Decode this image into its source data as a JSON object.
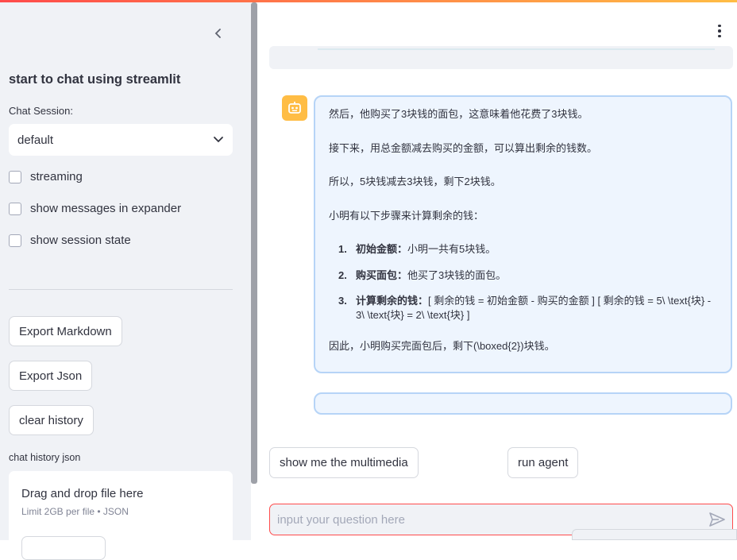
{
  "sidebar": {
    "title": "start to chat using streamlit",
    "session_label": "Chat Session:",
    "session_value": "default",
    "checkboxes": [
      {
        "label": "streaming",
        "checked": false
      },
      {
        "label": "show messages in expander",
        "checked": false
      },
      {
        "label": "show session state",
        "checked": false
      }
    ],
    "buttons": {
      "export_markdown": "Export Markdown",
      "export_json": "Export Json",
      "clear_history": "clear history"
    },
    "history_label": "chat history json",
    "dropzone": {
      "title": "Drag and drop file here",
      "subtitle": "Limit 2GB per file • JSON"
    }
  },
  "chat": {
    "message": {
      "p1": "然后，他购买了3块钱的面包，这意味着他花费了3块钱。",
      "p2": "接下来，用总金额减去购买的金额，可以算出剩余的钱数。",
      "p3": "所以，5块钱减去3块钱，剩下2块钱。",
      "p4": "小明有以下步骤来计算剩余的钱：",
      "steps": [
        {
          "num": "1.",
          "title": "初始金额：",
          "text": "小明一共有5块钱。"
        },
        {
          "num": "2.",
          "title": "购买面包：",
          "text": "他买了3块钱的面包。"
        },
        {
          "num": "3.",
          "title": "计算剩余的钱：",
          "text": "[ 剩余的钱 = 初始金额 - 购买的金额 ] [ 剩余的钱 = 5\\ \\text{块} - 3\\ \\text{块} = 2\\ \\text{块} ]"
        }
      ],
      "p5": "因此，小明购买完面包后，剩下(\\boxed{2})块钱。"
    }
  },
  "actions": {
    "multimedia": "show me the multimedia",
    "run_agent": "run agent"
  },
  "input": {
    "placeholder": "input your question here"
  },
  "colors": {
    "accent": "#ff4b4b",
    "assistant_avatar": "#ffbd45",
    "bubble_bg": "#eef5fe",
    "bubble_border": "#b6d4f7"
  }
}
